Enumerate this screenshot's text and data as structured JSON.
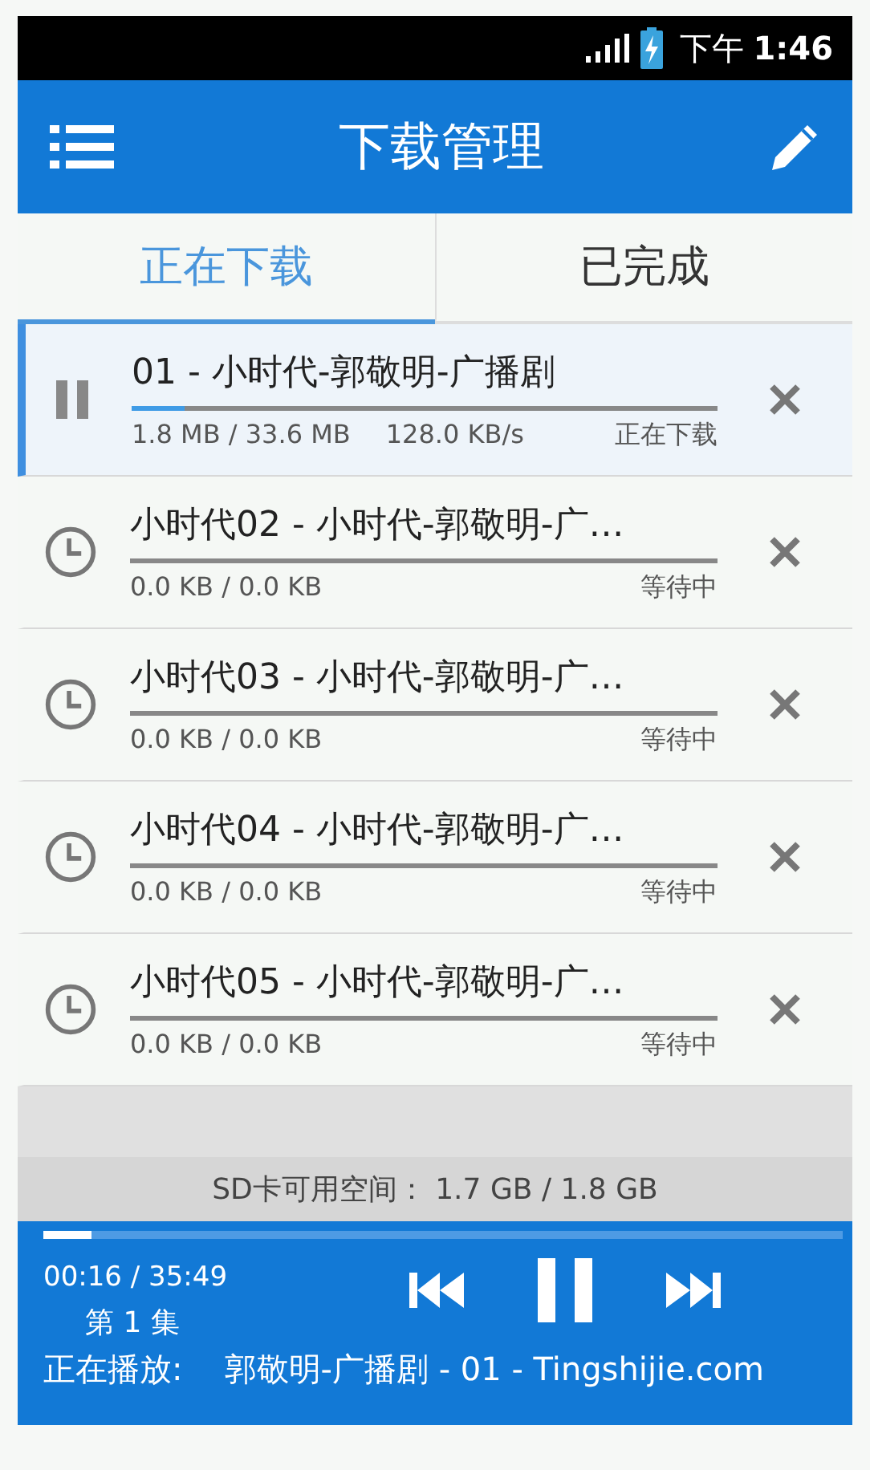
{
  "status_bar": {
    "time_period": "下午",
    "time": "1:46"
  },
  "app_bar": {
    "title": "下载管理"
  },
  "tabs": [
    {
      "label": "正在下载",
      "selected": true
    },
    {
      "label": "已完成",
      "selected": false
    }
  ],
  "downloads": [
    {
      "kind": "downloading",
      "title": "01 - 小时代-郭敬明-广播剧",
      "level": 0.09,
      "size": "1.8 MB / 33.6 MB",
      "speed": "128.0 KB/s",
      "state": "正在下载",
      "selected": true
    },
    {
      "kind": "waiting",
      "title": "小时代02 - 小时代-郭敬明-广…",
      "size": "0.0 KB / 0.0 KB",
      "state": "等待中",
      "selected": false
    },
    {
      "kind": "waiting",
      "title": "小时代03 - 小时代-郭敬明-广…",
      "size": "0.0 KB / 0.0 KB",
      "state": "等待中",
      "selected": false
    },
    {
      "kind": "waiting",
      "title": "小时代04 - 小时代-郭敬明-广…",
      "size": "0.0 KB / 0.0 KB",
      "state": "等待中",
      "selected": false
    },
    {
      "kind": "waiting",
      "title": "小时代05 - 小时代-郭敬明-广…",
      "size": "0.0 KB / 0.0 KB",
      "state": "等待中",
      "selected": false
    }
  ],
  "storage": "SD卡可用空间： 1.7 GB / 1.8 GB",
  "player": {
    "level": 0.06,
    "time": "00:16 / 35:49",
    "episode": "第 1 集",
    "playing": true,
    "now_playing_label": "正在播放:",
    "now_playing": "郭敬明-广播剧 - 01 - Tingshijie.com"
  }
}
